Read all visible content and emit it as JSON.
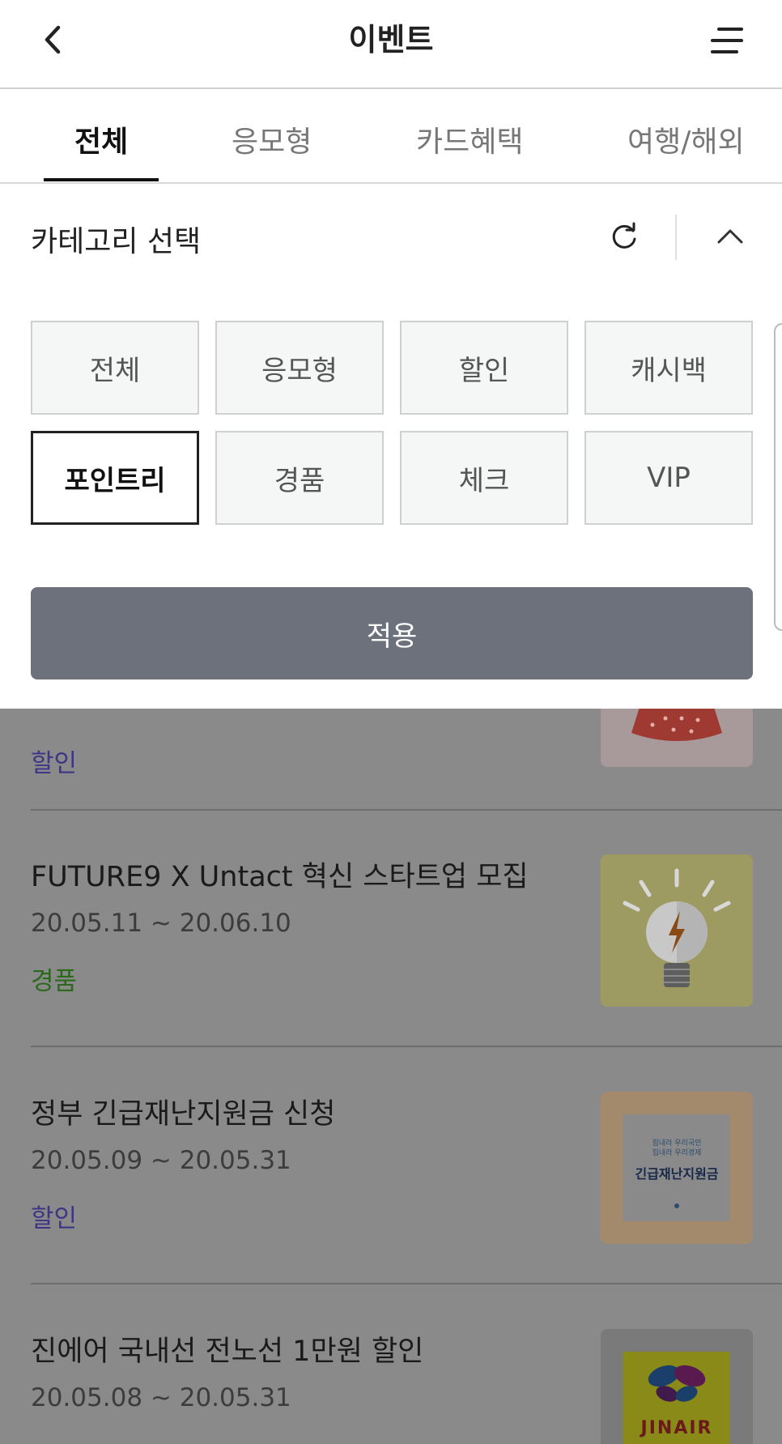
{
  "header": {
    "title": "이벤트"
  },
  "tabs": [
    {
      "label": "전체",
      "active": true
    },
    {
      "label": "응모형"
    },
    {
      "label": "카드혜택"
    },
    {
      "label": "여행/해외"
    }
  ],
  "panel": {
    "title": "카테고리 선택",
    "categories": [
      "전체",
      "응모형",
      "할인",
      "캐시백",
      "포인트리",
      "경품",
      "체크",
      "VIP"
    ],
    "selected": "포인트리",
    "apply_label": "적용"
  },
  "events": [
    {
      "category": "할인",
      "category_color": "#3d3585"
    },
    {
      "title": "FUTURE9 X Untact 혁신 스타트업 모집",
      "date": "20.05.11 ~ 20.06.10",
      "category": "경품",
      "category_color": "#2b6a1c"
    },
    {
      "title": "정부 긴급재난지원금 신청",
      "date": "20.05.09 ~ 20.05.31",
      "category": "할인",
      "category_color": "#3d3585",
      "thumb_lines": [
        "힘내라 우리국민",
        "힘내라 우리경제"
      ],
      "thumb_headline": "긴급재난지원금"
    },
    {
      "title": "진에어 국내선 전노선 1만원 할인",
      "date": "20.05.08 ~ 20.05.31",
      "thumb_logo": "JINAIR"
    }
  ],
  "colors": {
    "apply_button": "#6c717b",
    "overlay": "#8a8a8a",
    "selected_border": "#222222"
  }
}
